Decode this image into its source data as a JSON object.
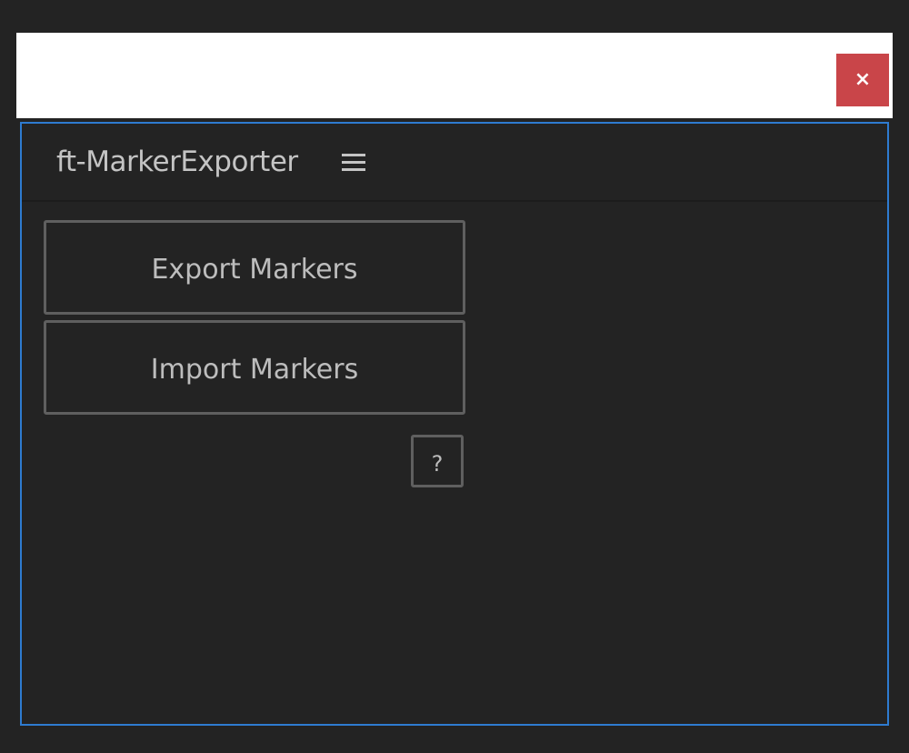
{
  "window": {
    "close_label": "×"
  },
  "panel": {
    "title": "ft-MarkerExporter",
    "menu_icon": "hamburger-menu-icon"
  },
  "actions": {
    "export_label": "Export Markers",
    "import_label": "Import Markers",
    "help_label": "?"
  },
  "colors": {
    "background": "#232323",
    "titlebar": "#ffffff",
    "close_button": "#c94549",
    "panel_border": "#2e7bd0",
    "button_border": "#5f5f5f",
    "text": "#c4c4c4"
  }
}
